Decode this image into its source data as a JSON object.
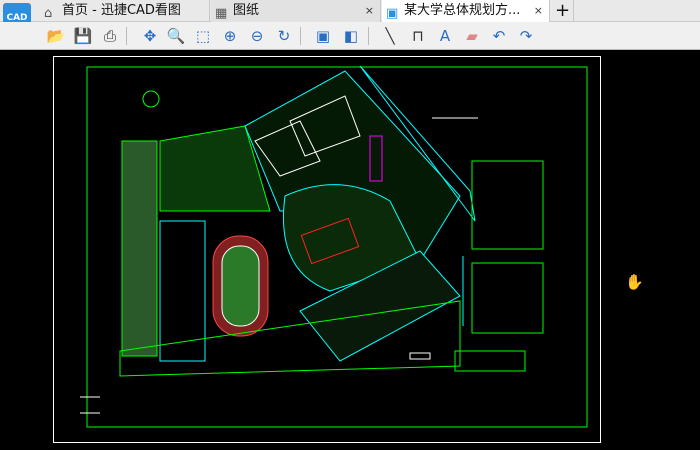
{
  "app": {
    "logo_text": "CAD"
  },
  "tabs": [
    {
      "label": "首页 - 迅捷CAD看图",
      "icon": "home-icon"
    },
    {
      "label": "图纸",
      "icon": "grid-icon",
      "close": "×"
    },
    {
      "label": "某大学总体规划方...",
      "icon": "cad-file-icon",
      "close": "×",
      "active": true
    }
  ],
  "new_tab": "+",
  "toolbar": [
    "open-icon",
    "save-icon",
    "print-icon",
    "pan-icon",
    "zoom-realtime-icon",
    "zoom-window-icon",
    "zoom-in-icon",
    "zoom-out-icon",
    "zoom-previous-icon",
    "3d-view-icon",
    "layer-icon",
    "measure-line-icon",
    "dimension-icon",
    "text-icon",
    "eraser-icon",
    "undo-icon",
    "redo-icon"
  ],
  "colors": {
    "background": "#000000",
    "lines": "#00ff00",
    "cyan": "#00ffff",
    "magenta": "#ff00ff",
    "red": "#ff2020"
  }
}
